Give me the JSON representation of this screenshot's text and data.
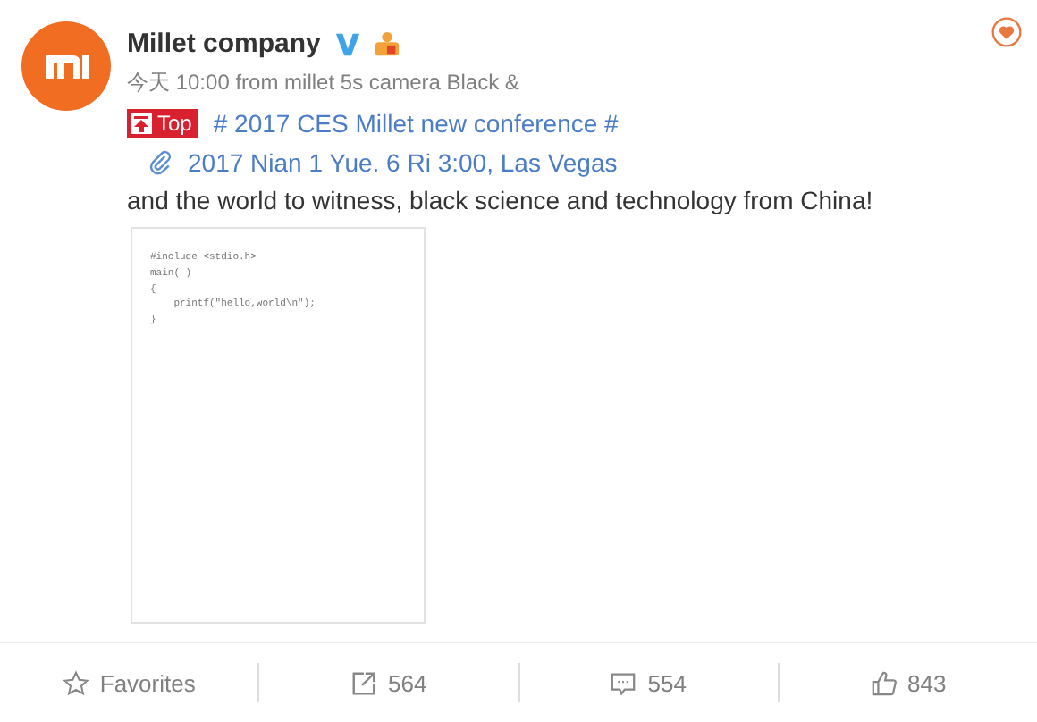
{
  "post": {
    "author": "Millet company",
    "time": "今天 10:00",
    "source": "from millet 5s camera Black &",
    "top_label": "Top",
    "topic": "# 2017 CES Millet new conference #",
    "link": "2017 Nian 1 Yue. 6 Ri 3:00, Las Vegas",
    "text": "and the world to witness, black science and technology from China!",
    "image": {
      "code_lines": [
        "#include <stdio.h>",
        "main( )",
        "{",
        "    printf(\"hello,world\\n\");",
        "}"
      ]
    }
  },
  "actions": [
    {
      "kind": "favorite",
      "label": "Favorites"
    },
    {
      "kind": "repost",
      "label": "564"
    },
    {
      "kind": "comment",
      "label": "554"
    },
    {
      "kind": "like",
      "label": "843"
    }
  ]
}
